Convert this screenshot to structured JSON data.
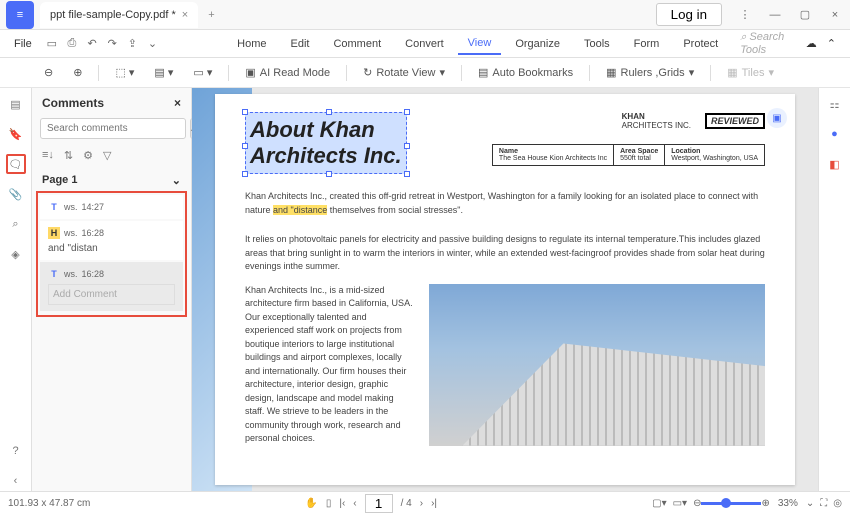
{
  "titlebar": {
    "tab_name": "ppt file-sample-Copy.pdf *",
    "login": "Log in"
  },
  "menubar": {
    "file": "File",
    "items": [
      "Home",
      "Edit",
      "Comment",
      "Convert",
      "View",
      "Organize",
      "Tools",
      "Form",
      "Protect"
    ],
    "active_index": 4,
    "search_placeholder": "Search Tools"
  },
  "toolbar": {
    "ai_read": "AI Read Mode",
    "rotate": "Rotate View",
    "auto_bookmarks": "Auto Bookmarks",
    "rulers": "Rulers ,Grids",
    "tiles": "Tiles"
  },
  "panel": {
    "title": "Comments",
    "search_placeholder": "Search comments",
    "page_label": "Page 1",
    "comments": [
      {
        "badge": "T",
        "badge_class": "cm-t",
        "user": "ws.",
        "time": "14:27",
        "text": ""
      },
      {
        "badge": "H",
        "badge_class": "cm-h",
        "user": "ws.",
        "time": "16:28",
        "text": "and \"distan"
      },
      {
        "badge": "T",
        "badge_class": "cm-t",
        "user": "ws.",
        "time": "16:28",
        "text": ""
      }
    ],
    "add_comment_placeholder": "Add Comment"
  },
  "document": {
    "title_line1": "About Khan",
    "title_line2": "Architects Inc.",
    "brand_name": "KHAN",
    "brand_sub": "ARCHITECTS INC.",
    "reviewed": "REVIEWED",
    "info": [
      {
        "label": "Name",
        "value": "The Sea House Kion Architects Inc"
      },
      {
        "label": "Area Space",
        "value": "550ft total"
      },
      {
        "label": "Location",
        "value": "Westport, Washington, USA"
      }
    ],
    "para1_pre": "Khan Architects Inc., created this off-grid retreat in Westport, Washington for a family looking for an isolated place to connect with nature ",
    "para1_hl": "and \"distance",
    "para1_post": " themselves from social stresses\".",
    "para2": "It relies on photovoltaic panels for electricity and passive building designs to regulate its internal temperature.This includes glazed areas that bring sunlight in to warm the interiors in winter, while an extended west-facingroof provides shade from solar heat during evenings inthe summer.",
    "para3": "Khan Architects Inc., is a mid-sized architecture firm based in California, USA. Our exceptionally talented and experienced staff work on projects from boutique interiors to large institutional buildings and airport complexes, locally and internationally. Our firm houses their architecture, interior design, graphic design, landscape and model making staff. We strieve to be leaders in the community through work, research and personal choices."
  },
  "statusbar": {
    "coords": "101.93 x 47.87 cm",
    "page_current": "1",
    "page_total": "/ 4",
    "zoom": "33%"
  }
}
